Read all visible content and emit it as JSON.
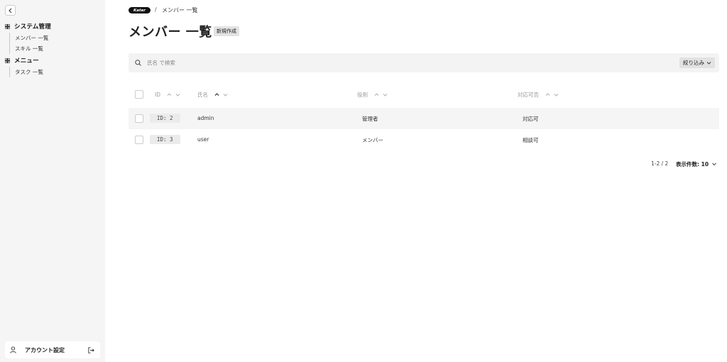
{
  "sidebar": {
    "groups": [
      {
        "title": "システム管理",
        "items": [
          "メンバー 一覧",
          "スキル 一覧"
        ]
      },
      {
        "title": "メニュー",
        "items": [
          "タスク 一覧"
        ]
      }
    ],
    "account_label": "アカウント設定"
  },
  "header": {
    "logo_text": "Kater",
    "breadcrumb_sep": "/",
    "breadcrumb_current": "メンバー 一覧",
    "title": "メンバー 一覧",
    "new_button": "新規作成"
  },
  "search": {
    "placeholder": "氏名 で検索",
    "filter_label": "絞り込み"
  },
  "table": {
    "columns": [
      "ID",
      "氏名",
      "役割",
      "対応可否"
    ],
    "rows": [
      {
        "id": "ID: 2",
        "name": "admin",
        "role": "管理者",
        "status": "対応可"
      },
      {
        "id": "ID: 3",
        "name": "user",
        "role": "メンバー",
        "status": "相談可"
      }
    ]
  },
  "pagination": {
    "range": "1-2 / 2",
    "page_size_label": "表示件数: 10"
  }
}
